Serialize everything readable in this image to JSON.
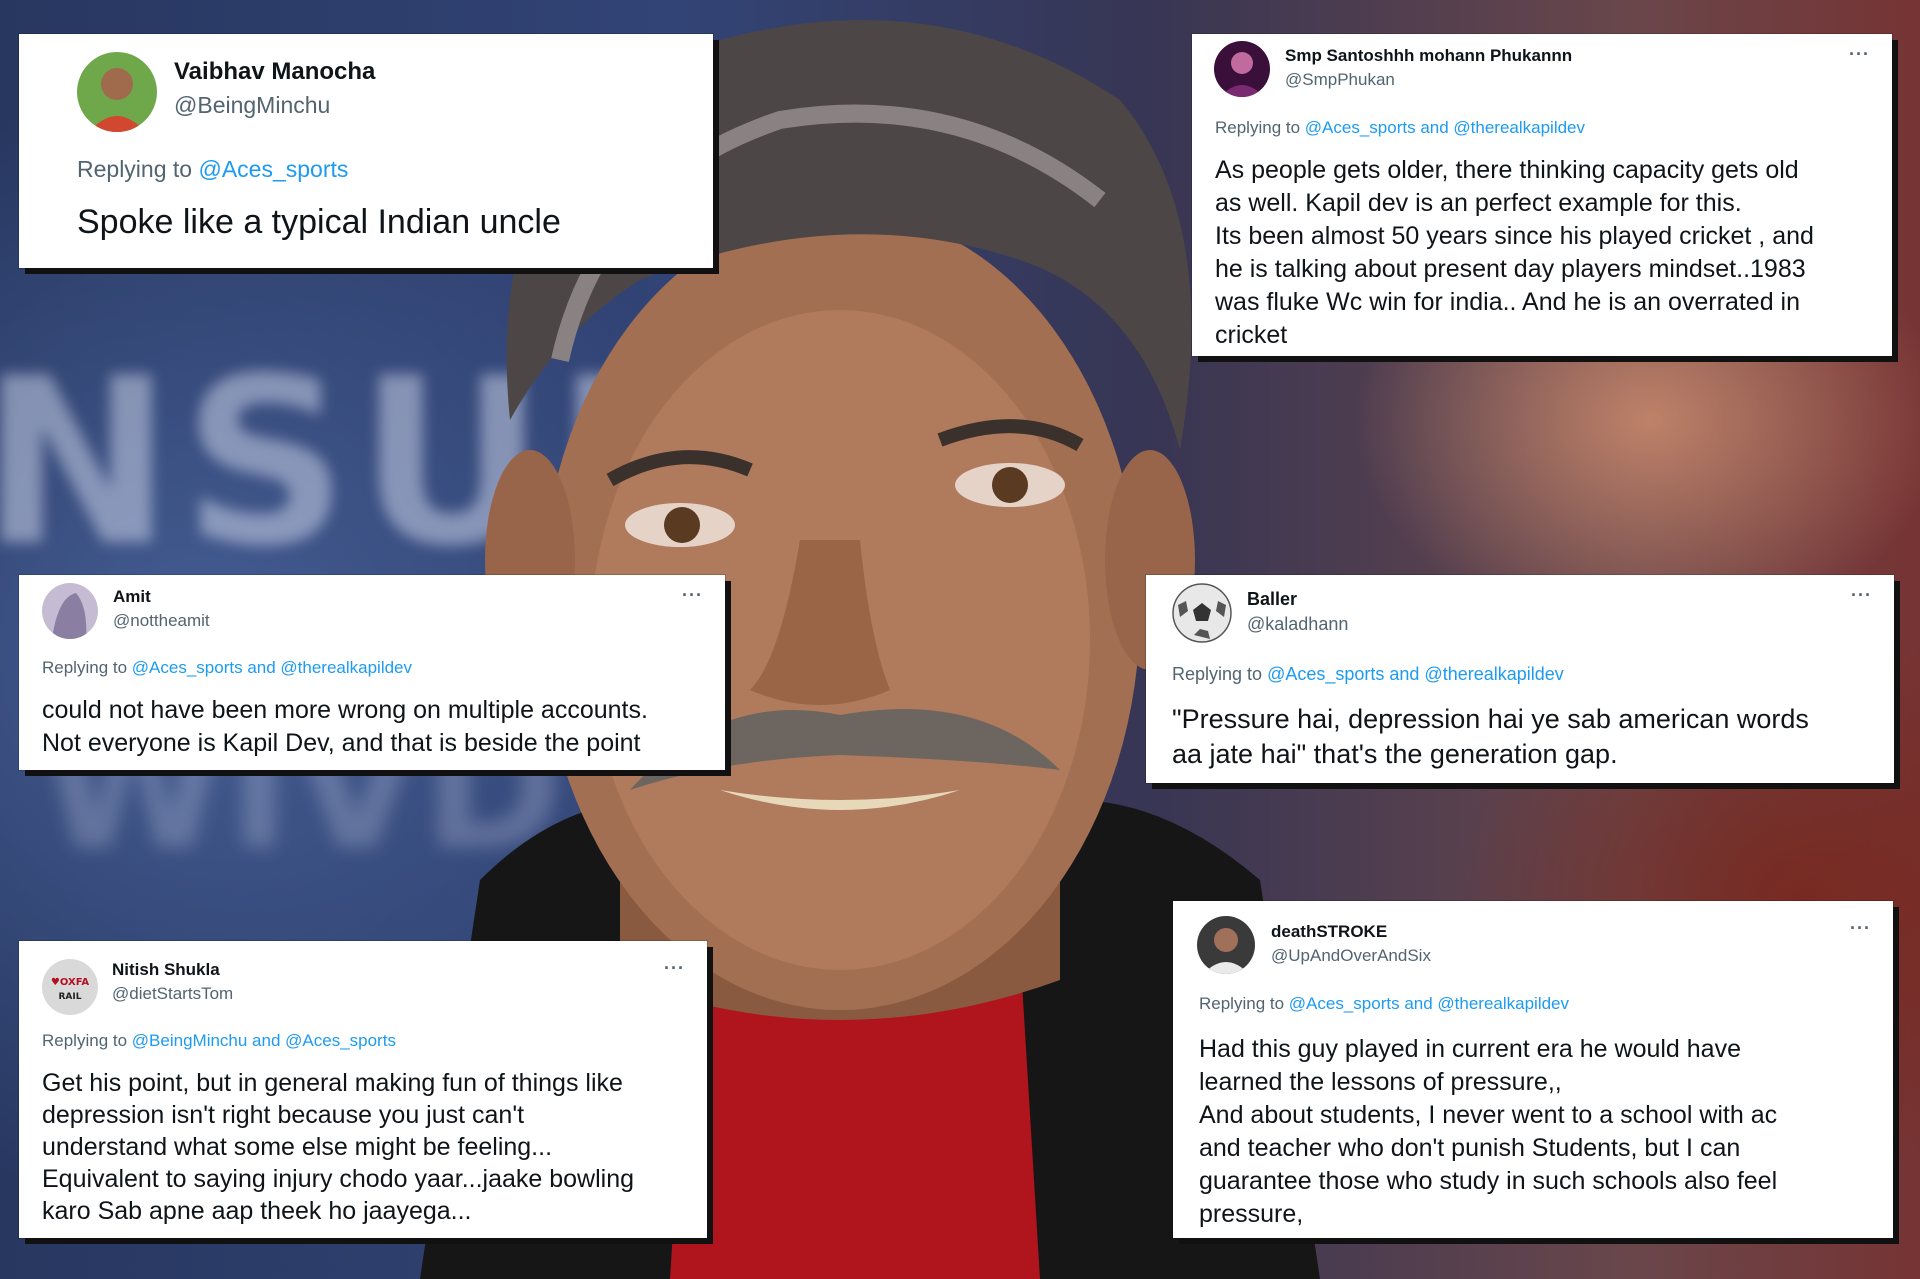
{
  "tweets": [
    {
      "display_name": "Vaibhav Manocha",
      "handle": "@BeingMinchu",
      "replying_prefix": "Replying to",
      "reply_mentions": "@Aces_sports",
      "text": "Spoke like a typical Indian uncle",
      "avatar_color": "#5a8f3c"
    },
    {
      "display_name": "Smp Santoshhh mohann Phukannn",
      "handle": "@SmpPhukan",
      "more_label": "···",
      "replying_prefix": "Replying to",
      "reply_mentions": "@Aces_sports and @therealkapildev",
      "text": "As people gets older, there thinking capacity gets old\nas well.  Kapil dev is an perfect example for this.\n Its been almost 50 years since his played cricket , and\nhe is talking about present day players mindset..1983\nwas fluke Wc win for india.. And he is an overrated in\ncricket",
      "avatar_color": "#5a1a55"
    },
    {
      "display_name": "Amit",
      "handle": "@nottheamit",
      "more_label": "···",
      "replying_prefix": "Replying to",
      "reply_mentions": "@Aces_sports and @therealkapildev",
      "text": "could not have been more wrong on multiple accounts.\nNot everyone is Kapil Dev, and that is beside the point",
      "avatar_color": "#9a8fb0"
    },
    {
      "display_name": "Baller",
      "handle": "@kaladhann",
      "more_label": "···",
      "replying_prefix": "Replying to",
      "reply_mentions": "@Aces_sports and @therealkapildev",
      "text": "\"Pressure hai, depression hai ye sab american words\naa jate hai\" that's the generation gap.",
      "avatar_color": "#d8d8d8"
    },
    {
      "display_name": "Nitish Shukla",
      "handle": "@dietStartsTom",
      "more_label": "···",
      "replying_prefix": "Replying to",
      "reply_mentions": "@BeingMinchu and @Aces_sports",
      "text": "Get his point, but in general making fun of things like\ndepression isn't right because you just can't\nunderstand what some else might be feeling...\nEquivalent to saying injury chodo yaar...jaake bowling\nkaro Sab apne aap theek ho jaayega...",
      "avatar_color": "#c9c9c9"
    },
    {
      "display_name": "deathSTROKE",
      "handle": "@UpAndOverAndSix",
      "more_label": "···",
      "replying_prefix": "Replying to",
      "reply_mentions": "@Aces_sports and @therealkapildev",
      "text": "Had this guy played in current era he would have\nlearned the lessons of pressure,,\nAnd about students, I never went to a school with ac\nand teacher who don't punish Students, but I can\nguarantee those who study in such schools also feel\npressure,",
      "avatar_color": "#2a2a2a"
    }
  ],
  "colors": {
    "link": "#1d9bf0",
    "muted": "#536471",
    "text": "#0f1419"
  }
}
